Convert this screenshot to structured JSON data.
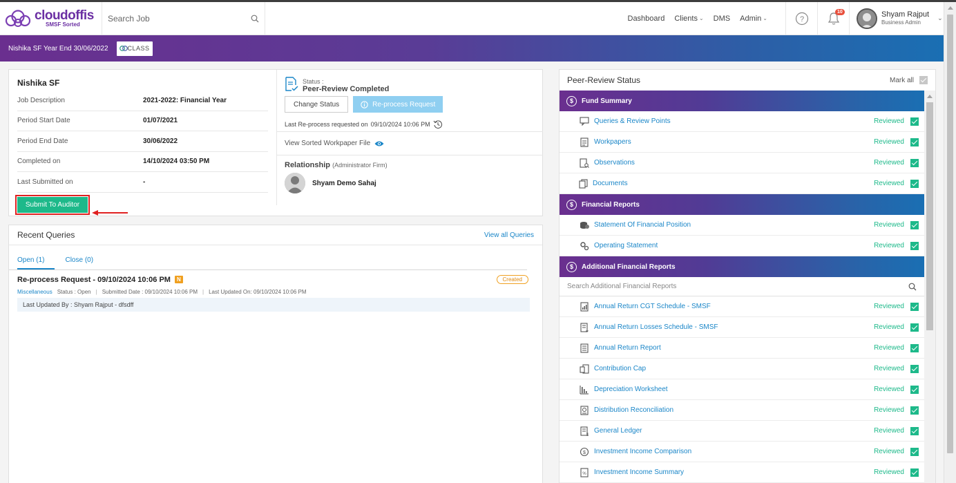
{
  "header": {
    "logo_name": "cloudoffis",
    "logo_sub": "SMSF Sorted",
    "search_placeholder": "Search Job",
    "nav": [
      {
        "label": "Dashboard",
        "dropdown": false
      },
      {
        "label": "Clients",
        "dropdown": true
      },
      {
        "label": "DMS",
        "dropdown": false
      },
      {
        "label": "Admin",
        "dropdown": true
      }
    ],
    "notification_count": "10",
    "user_name": "Shyam Rajput",
    "user_role": "Business Admin"
  },
  "banner": {
    "title": "Nishika SF Year End 30/06/2022",
    "integration_logo": "CLASS"
  },
  "job": {
    "fund_name": "Nishika SF",
    "details": [
      {
        "label": "Job Description",
        "value": "2021-2022: Financial Year"
      },
      {
        "label": "Period Start Date",
        "value": "01/07/2021"
      },
      {
        "label": "Period End Date",
        "value": "30/06/2022"
      },
      {
        "label": "Completed on",
        "value": "14/10/2024 03:50 PM"
      },
      {
        "label": "Last Submitted on",
        "value": "-"
      }
    ],
    "submit_button": "Submit To Auditor",
    "status_label": "Status :",
    "status_value": "Peer-Review Completed",
    "change_status_button": "Change Status",
    "reprocess_button": "Re-process Request",
    "reprocess_text": "Last Re-process requested on",
    "reprocess_time": "09/10/2024 10:06 PM",
    "workpaper_link": "View Sorted Workpaper File",
    "relationship_title": "Relationship",
    "relationship_sub": "(Administrator Firm)",
    "relationship_person": "Shyam Demo Sahaj"
  },
  "queries": {
    "title": "Recent Queries",
    "view_all": "View all Queries",
    "tabs": [
      {
        "label": "Open (1)",
        "active": true
      },
      {
        "label": "Close (0)",
        "active": false
      }
    ],
    "items": [
      {
        "title": "Re-process Request - 09/10/2024 10:06 PM",
        "badge": "N",
        "state": "Created",
        "category": "Miscellaneous",
        "status": "Status : Open",
        "submitted": "Submitted Date : 09/10/2024 10:06 PM",
        "updated": "Last Updated On: 09/10/2024 10:06 PM",
        "updated_by": "Last Updated By : Shyam Rajput - dfsdff"
      }
    ]
  },
  "peer_review": {
    "title": "Peer-Review Status",
    "mark_all": "Mark all",
    "reviewed_label": "Reviewed",
    "sections": [
      {
        "title": "Fund Summary",
        "icon": "dollar-gear-icon",
        "items": [
          "Queries & Review Points",
          "Workpapers",
          "Observations",
          "Documents"
        ]
      },
      {
        "title": "Financial Reports",
        "icon": "dollar-gear-icon",
        "items": [
          "Statement Of Financial Position",
          "Operating Statement"
        ]
      },
      {
        "title": "Additional Financial Reports",
        "icon": "dollar-icon",
        "search_placeholder": "Search Additional Financial Reports",
        "items": [
          "Annual Return CGT Schedule - SMSF",
          "Annual Return Losses Schedule - SMSF",
          "Annual Return Report",
          "Contribution Cap",
          "Depreciation Worksheet",
          "Distribution Reconciliation",
          "General Ledger",
          "Investment Income Comparison",
          "Investment Income Summary"
        ]
      }
    ]
  },
  "colors": {
    "brand_purple": "#6a2f8f",
    "brand_blue": "#1a6fb3",
    "accent_green": "#1db98a",
    "link_blue": "#1a86c8",
    "highlight_red": "#e02020",
    "badge_orange": "#f0a020"
  }
}
